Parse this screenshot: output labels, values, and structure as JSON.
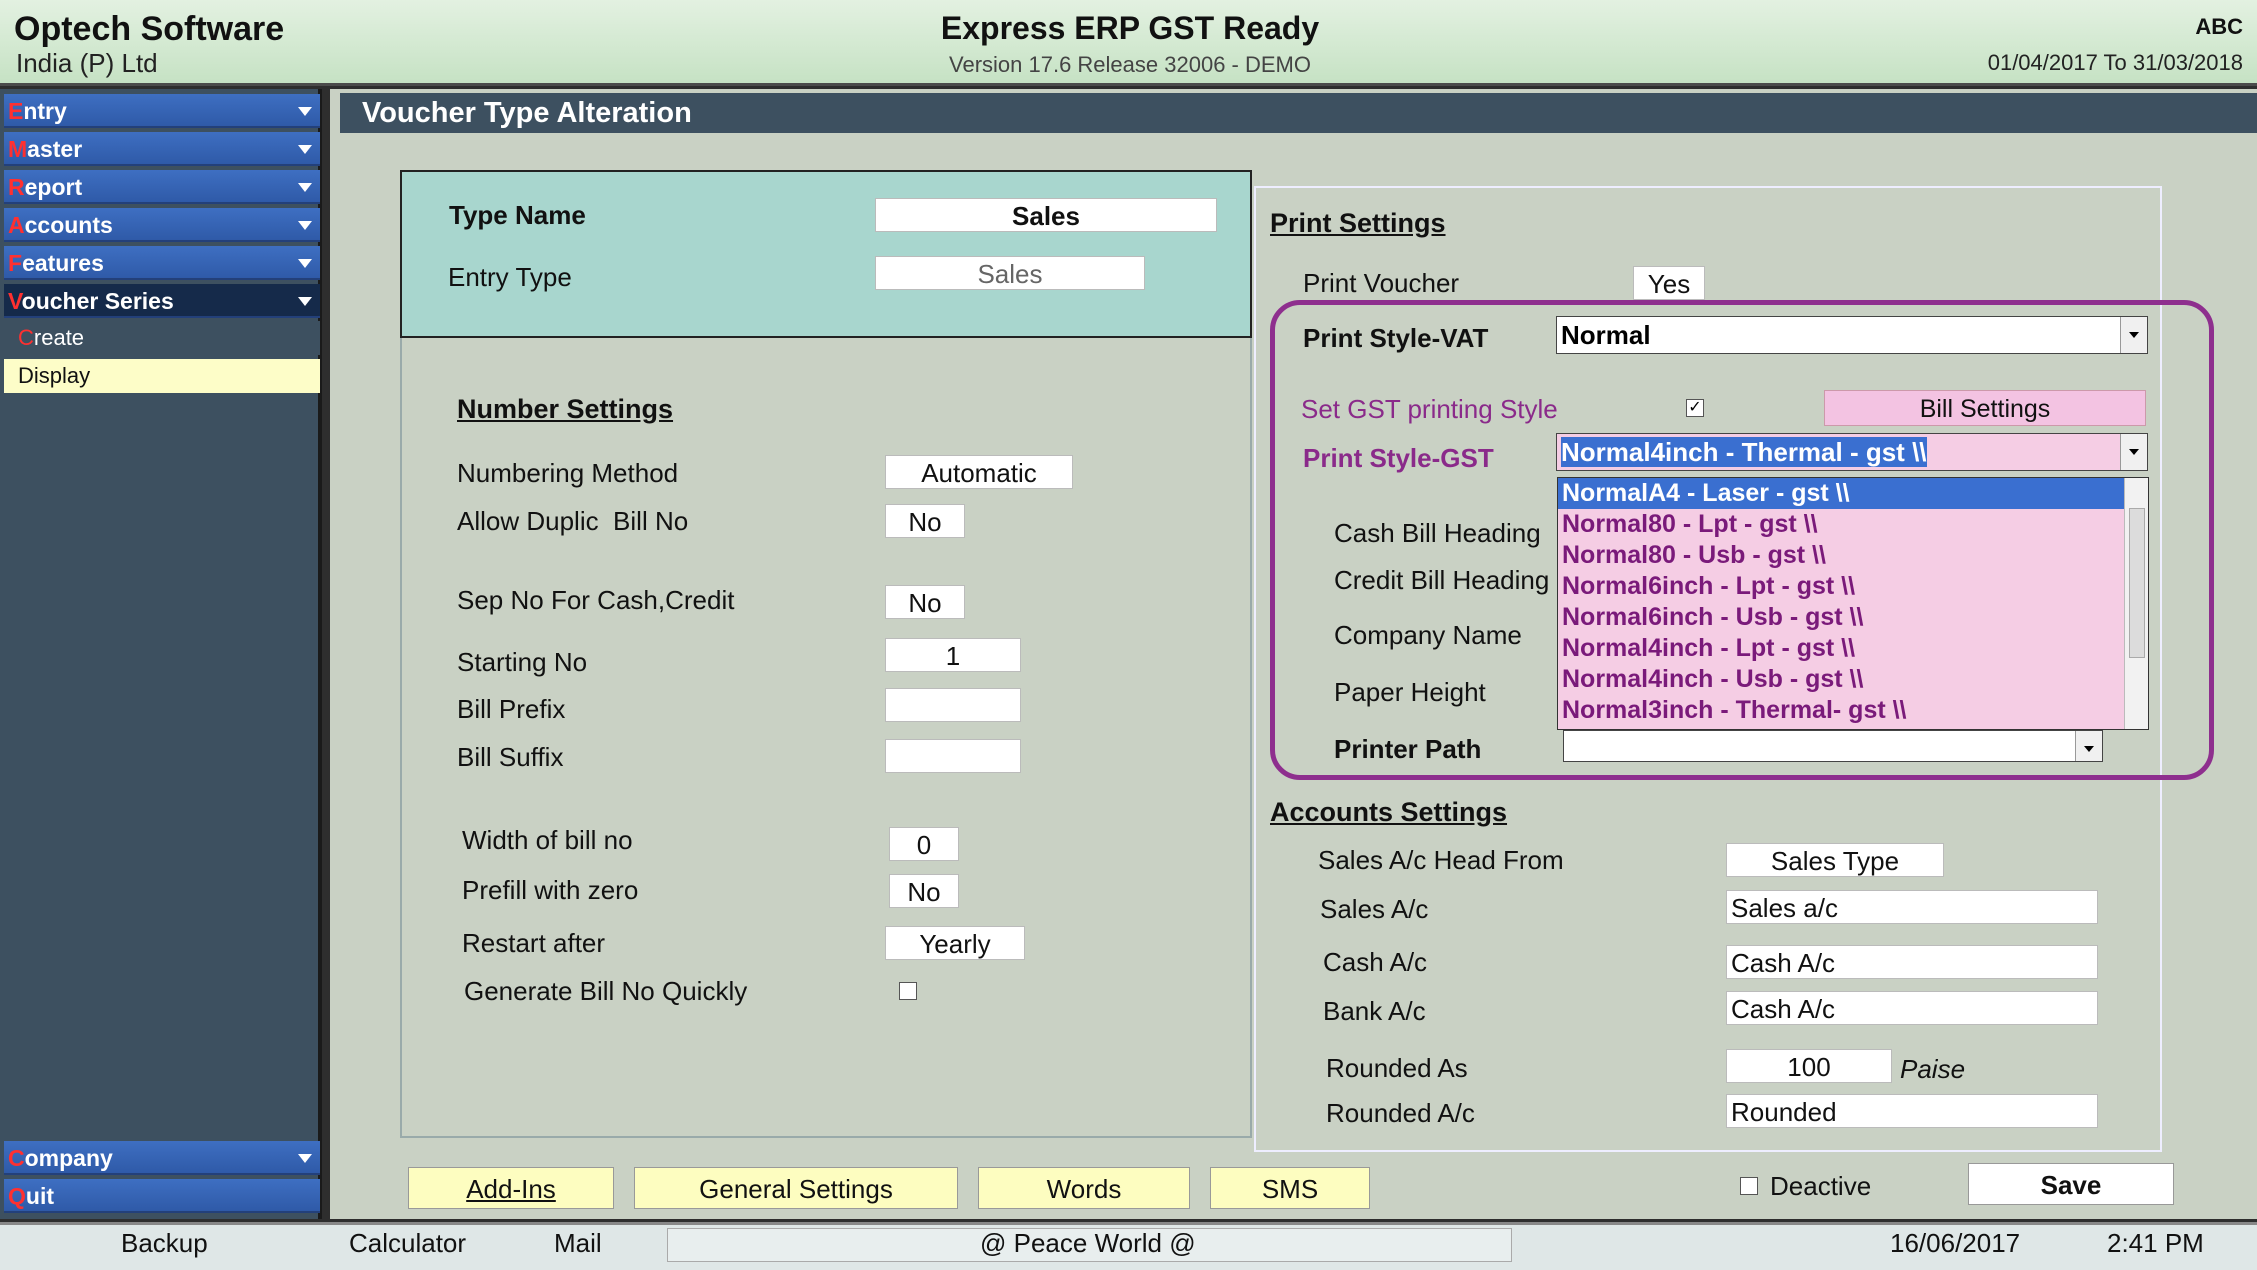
{
  "header": {
    "company": "Optech Software",
    "company_sub": "India (P) Ltd",
    "app_title": "Express ERP GST Ready",
    "version": "Version 17.6 Release 32006 - DEMO",
    "user": "ABC",
    "period": "01/04/2017 To 31/03/2018"
  },
  "sidebar": {
    "menus": [
      {
        "first": "E",
        "rest": "ntry"
      },
      {
        "first": "M",
        "rest": "aster"
      },
      {
        "first": "R",
        "rest": "eport"
      },
      {
        "first": "A",
        "rest": "ccounts"
      },
      {
        "first": "F",
        "rest": "eatures"
      },
      {
        "first": "V",
        "rest": "oucher Series"
      }
    ],
    "sub_create_first": "C",
    "sub_create_rest": "reate",
    "sub_display": "Display",
    "company": {
      "first": "C",
      "rest": "ompany"
    },
    "quit": {
      "first": "Q",
      "rest": "uit"
    }
  },
  "page_title": "Voucher Type Alteration",
  "type": {
    "name_label": "Type Name",
    "name_value": "Sales",
    "entry_label": "Entry Type",
    "entry_value": "Sales"
  },
  "number_settings": {
    "heading": "Number Settings",
    "numbering_method_label": "Numbering Method",
    "numbering_method_value": "Automatic",
    "allow_duplic_label": "Allow Duplic  Bill No",
    "allow_duplic_value": "No",
    "sep_no_label": "Sep No For Cash,Credit",
    "sep_no_value": "No",
    "starting_no_label": "Starting No",
    "starting_no_value": "1",
    "bill_prefix_label": "Bill Prefix",
    "bill_prefix_value": "",
    "bill_suffix_label": "Bill Suffix",
    "bill_suffix_value": "",
    "width_label": "Width of bill no",
    "width_value": "0",
    "prefill_label": "Prefill with zero",
    "prefill_value": "No",
    "restart_label": "Restart after",
    "restart_value": "Yearly",
    "generate_label": "Generate Bill No Quickly",
    "generate_checked": false
  },
  "print_settings": {
    "heading": "Print Settings",
    "print_voucher_label": "Print Voucher",
    "print_voucher_value": "Yes",
    "style_vat_label": "Print Style-VAT",
    "style_vat_value": "Normal",
    "set_gst_label": "Set GST printing Style",
    "set_gst_check": "✓",
    "bill_settings_label": "Bill Settings",
    "style_gst_label": "Print Style-GST",
    "style_gst_value": "Normal4inch - Thermal - gst \\\\",
    "cash_bill_heading_label": "Cash Bill Heading",
    "credit_bill_heading_label": "Credit Bill Heading",
    "company_name_label": "Company Name",
    "paper_height_label": "Paper Height",
    "printer_path_label": "Printer Path",
    "dropdown_options": [
      "NormalA4 - Laser - gst \\\\",
      "Normal80 - Lpt - gst \\\\",
      "Normal80 - Usb - gst \\\\",
      "Normal6inch - Lpt - gst \\\\",
      "Normal6inch - Usb - gst \\\\",
      "Normal4inch - Lpt - gst \\\\",
      "Normal4inch - Usb - gst \\\\",
      "Normal3inch - Thermal- gst \\\\"
    ]
  },
  "accounts_settings": {
    "heading": "Accounts Settings",
    "head_from_label": "Sales A/c Head From",
    "head_from_value": "Sales Type",
    "sales_label": "Sales A/c",
    "sales_value": "Sales a/c",
    "cash_label": "Cash A/c",
    "cash_value": "Cash A/c",
    "bank_label": "Bank A/c",
    "bank_value": "Cash A/c",
    "rounded_as_label": "Rounded As",
    "rounded_as_value": "100",
    "rounded_as_unit": "Paise",
    "rounded_ac_label": "Rounded A/c",
    "rounded_ac_value": "Rounded"
  },
  "buttons": {
    "addins": "Add-Ins",
    "general_settings": "General Settings",
    "words": "Words",
    "sms": "SMS",
    "deactive": "Deactive",
    "save": "Save"
  },
  "statusbar": {
    "backup": "Backup",
    "calculator": "Calculator",
    "mail": "Mail",
    "message": "@ Peace World @",
    "date": "16/06/2017",
    "time": "2:41 PM"
  }
}
